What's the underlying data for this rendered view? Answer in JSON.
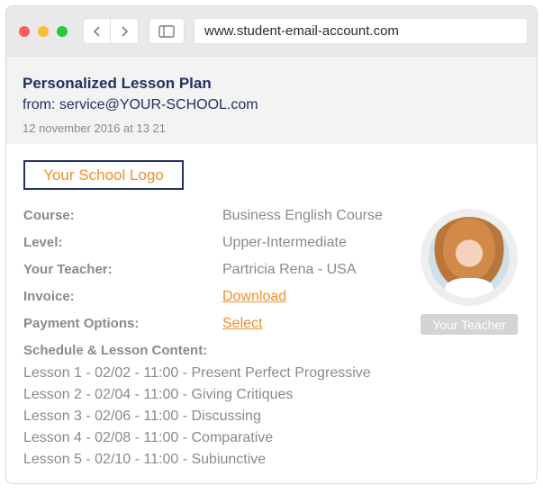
{
  "browser": {
    "address": "www.student-email-account.com",
    "icons": {
      "back": "chevron-left-icon",
      "forward": "chevron-right-icon",
      "sidebar": "sidebar-icon"
    }
  },
  "email": {
    "subject": "Personalized Lesson Plan",
    "from": "from: service@YOUR-SCHOOL.com",
    "date": "12 november 2016 at 13 21"
  },
  "body": {
    "logo_text": "Your School Logo",
    "rows": [
      {
        "label": "Course:",
        "value": "Business English Course"
      },
      {
        "label": "Level:",
        "value": "Upper-Intermediate"
      },
      {
        "label": "Your Teacher:",
        "value": "Partricia Rena - USA"
      },
      {
        "label": "Invoice:",
        "value": "Download"
      },
      {
        "label": "Payment Options:",
        "value": "Select"
      }
    ],
    "teacher_caption": "Your Teacher",
    "schedule_title": "Schedule & Lesson Content:",
    "lessons": [
      "Lesson 1 - 02/02 - 11:00 - Present Perfect Progressive",
      "Lesson 2 - 02/04 - 11:00 - Giving Critiques",
      "Lesson 3 - 02/06 - 11:00 - Discussing",
      "Lesson 4 - 02/08 - 11:00 - Comparative",
      "Lesson 5 - 02/10 - 11:00 - Subiunctive"
    ]
  },
  "colors": {
    "accent": "#f0902a",
    "navy": "#213260",
    "gray_text": "#8a8a8a"
  }
}
